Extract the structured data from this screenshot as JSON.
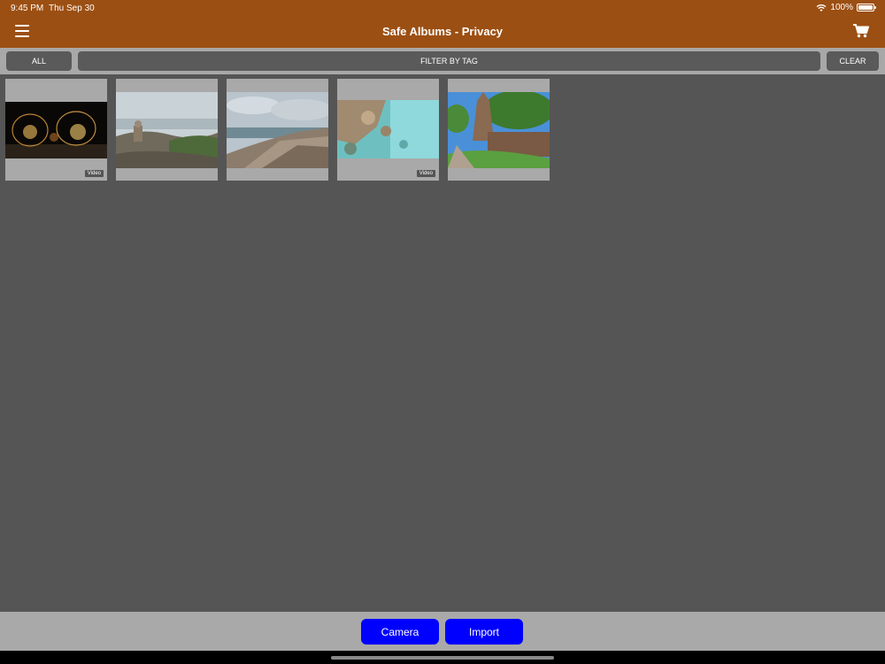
{
  "status": {
    "time": "9:45 PM",
    "date": "Thu Sep 30",
    "battery": "100%"
  },
  "nav": {
    "title": "Safe Albums - Privacy",
    "menu_icon": "menu-icon",
    "cart_icon": "cart-icon"
  },
  "filter": {
    "all_label": "ALL",
    "filter_label": "FILTER BY TAG",
    "clear_label": "CLEAR"
  },
  "thumbnails": [
    {
      "badge": "Video",
      "kind": "video"
    },
    {
      "badge": "",
      "kind": "photo"
    },
    {
      "badge": "",
      "kind": "photo"
    },
    {
      "badge": "Video",
      "kind": "video"
    },
    {
      "badge": "",
      "kind": "photo"
    }
  ],
  "toolbar": {
    "camera_label": "Camera",
    "import_label": "Import"
  },
  "colors": {
    "nav_bg": "#9c4f12",
    "content_bg": "#555555",
    "button_blue": "#0000ff",
    "bar_gray": "#a9a9a9"
  }
}
